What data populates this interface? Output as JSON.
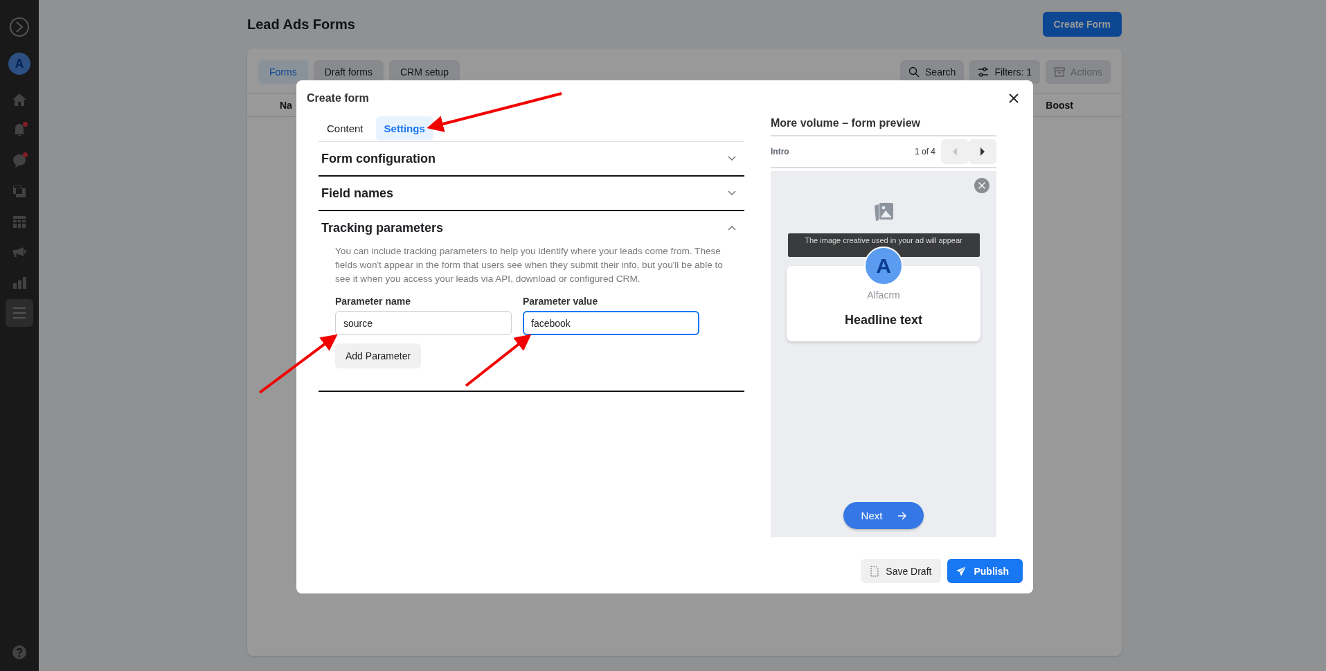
{
  "sidebar": {
    "avatar": "A",
    "items": [
      {
        "kind": "home",
        "selected": false,
        "badge": false
      },
      {
        "kind": "bell",
        "selected": false,
        "badge": true
      },
      {
        "kind": "chat",
        "selected": false,
        "badge": true
      },
      {
        "kind": "layers",
        "selected": false,
        "badge": false
      },
      {
        "kind": "table",
        "selected": false,
        "badge": false
      },
      {
        "kind": "megaphone",
        "selected": false,
        "badge": false
      },
      {
        "kind": "chart",
        "selected": false,
        "badge": false
      },
      {
        "kind": "menu",
        "selected": true,
        "badge": false
      }
    ]
  },
  "page": {
    "title": "Lead Ads Forms",
    "create_button": "Create Form",
    "tabs": [
      {
        "label": "Forms",
        "selected": true
      },
      {
        "label": "Draft forms",
        "selected": false
      },
      {
        "label": "CRM setup",
        "selected": false
      }
    ],
    "tools": [
      {
        "kind": "search",
        "label": "Search",
        "disabled": false
      },
      {
        "kind": "filter",
        "label": "Filters: 1",
        "disabled": false
      },
      {
        "kind": "archive",
        "label": "Actions",
        "disabled": true
      }
    ],
    "columns": [
      "Na",
      "Boost"
    ]
  },
  "modal": {
    "title": "Create form",
    "tabs": [
      {
        "label": "Content",
        "selected": false
      },
      {
        "label": "Settings",
        "selected": true
      }
    ],
    "sections": [
      {
        "title": "Form configuration",
        "expanded": false
      },
      {
        "title": "Field names",
        "expanded": false
      },
      {
        "title": "Tracking parameters",
        "expanded": true,
        "description": "You can include tracking parameters to help you identify where your leads come from. These fields won't appear in the form that users see when they submit their info, but you'll be able to see it when you access your leads via API, download or configured CRM.",
        "fields": [
          {
            "label": "Parameter name",
            "value": "source",
            "focused": false
          },
          {
            "label": "Parameter value",
            "value": "facebook",
            "focused": true
          }
        ],
        "add_button": "Add Parameter"
      }
    ],
    "preview": {
      "title": "More volume – form preview",
      "step": "Intro",
      "counter": "1 of 4",
      "prev_disabled": true,
      "next_disabled": false,
      "banner": "The image creative used in your ad will appear",
      "avatar": "A",
      "brand": "Alfacrm",
      "headline": "Headline text",
      "next_button": "Next"
    },
    "buttons": [
      {
        "kind": "draft",
        "label": "Save Draft"
      },
      {
        "kind": "publish",
        "label": "Publish"
      }
    ]
  }
}
